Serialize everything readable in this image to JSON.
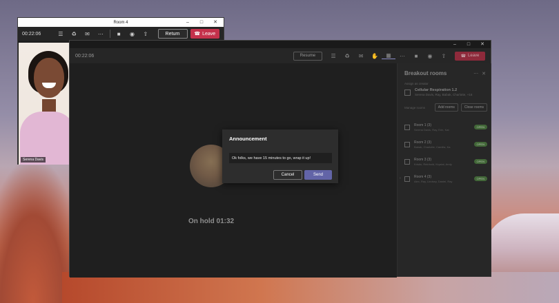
{
  "mini_window": {
    "title": "Room 4",
    "timer": "00:22:06",
    "return_label": "Return",
    "leave_label": "Leave",
    "participant_name": "Serena Davis"
  },
  "main_window": {
    "timer": "00:22:06",
    "return_label": "Resume",
    "leave_label": "Leave",
    "on_hold_text": "On hold 01:32"
  },
  "panel": {
    "title": "Breakout rooms",
    "assigned_label": "Assign as creator",
    "assigned_title": "Cellular Respiration 1.2",
    "assigned_sub": "Serena Davis, Ray, Babak, Charlotte, +16",
    "manage_label": "Manage rooms",
    "add_rooms": "Add rooms",
    "close_rooms": "Close rooms",
    "rooms": [
      {
        "name": "Room 1 (3)",
        "members": "Serena Davis, Ray, Erin, Kat",
        "status": "OPEN"
      },
      {
        "name": "Room 2 (3)",
        "members": "Babak, Charlotte, Camilla, Ka",
        "status": "OPEN"
      },
      {
        "name": "Room 3 (3)",
        "members": "Kristin, Reinhold, Krystal, Andy",
        "status": "OPEN"
      },
      {
        "name": "Room 4 (3)",
        "members": "Alex, Ray, Lindsey, Daniel, Ray",
        "status": "OPEN"
      }
    ]
  },
  "dialog": {
    "title": "Announcement",
    "message": "Ok folks, we have 15 minutes to go, wrap it up!",
    "cancel_label": "Cancel",
    "send_label": "Send"
  },
  "colors": {
    "accent": "#6264a7",
    "leave_red": "#c4314b",
    "open_green": "#4b7a3f"
  }
}
